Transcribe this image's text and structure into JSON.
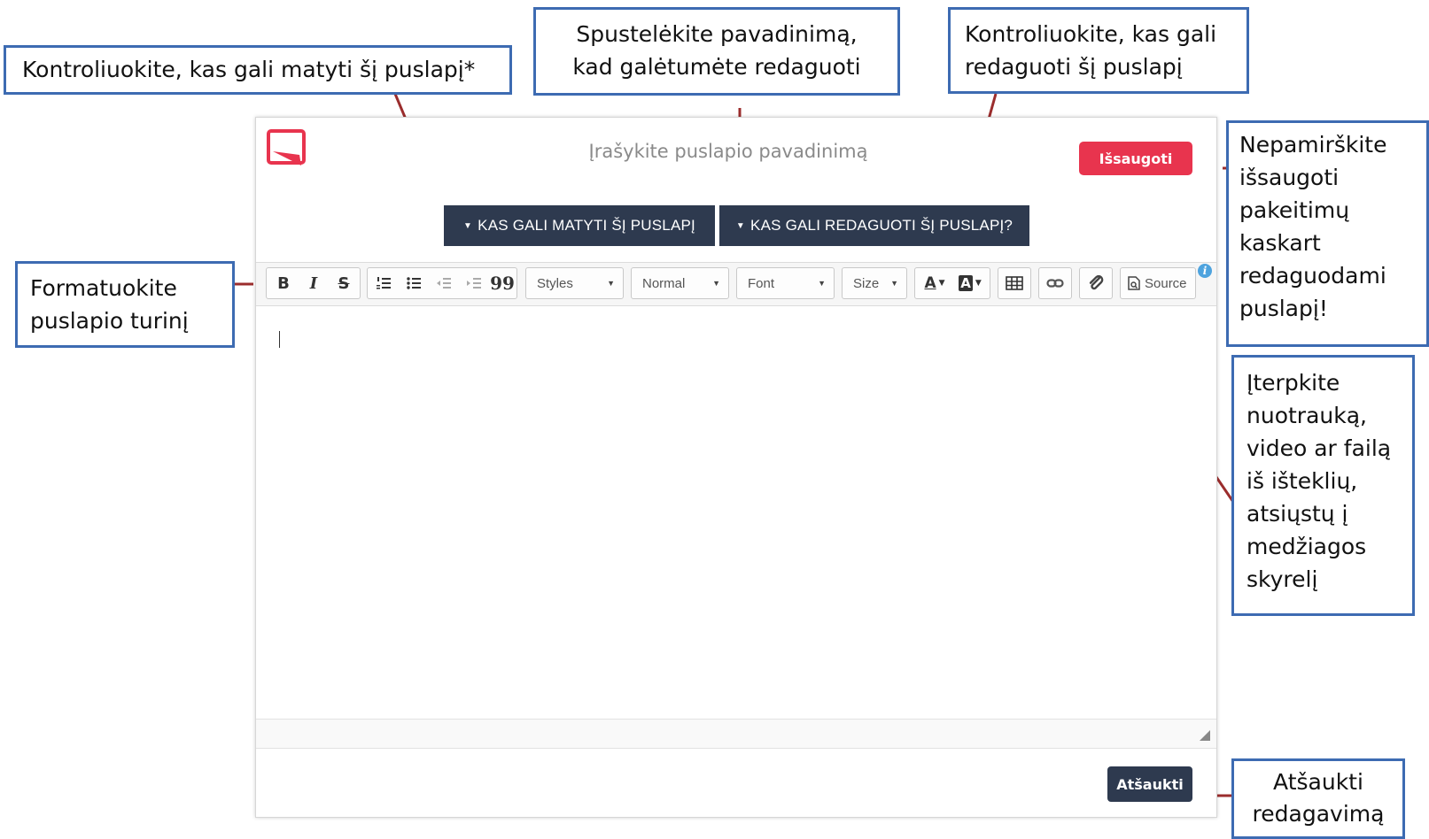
{
  "callouts": {
    "view_permissions": "Kontroliuokite, kas gali matyti šį puslapį*",
    "title_edit": "Spustelėkite pavadinimą,\nkad galėtumėte redaguoti",
    "edit_permissions": "Kontroliuokite, kas gali\nredaguoti šį puslapį",
    "save_reminder": "Nepamirškite\nišsaugoti\npakeitimų\nkaskart\nredaguodami\npuslapį!",
    "format_content": "Formatuokite\npuslapio turinį",
    "insert_media": "Įterpkite\nnuotrauką,\nvideo ar failą\niš išteklių,\natsiųstų į\nmedžiagos\nskyrelį",
    "cancel_editing": "Atšaukti\nredagavimą"
  },
  "editor": {
    "title_placeholder": "Įrašykite puslapio pavadinimą",
    "save_label": "Išsaugoti",
    "view_perm_label": "KAS GALI MATYTI ŠĮ PUSLAPĮ",
    "edit_perm_label": "KAS GALI REDAGUOTI ŠĮ PUSLAPĮ?",
    "cancel_label": "Atšaukti",
    "accent_color": "#e8344e",
    "dark_button_color": "#2e3a4f",
    "callout_border_color": "#3d6bb2",
    "leader_color": "#9b2d2d"
  },
  "toolbar": {
    "bold": "B",
    "italic": "I",
    "strike": "S",
    "styles": "Styles",
    "format": "Normal",
    "font": "Font",
    "size": "Size",
    "source": "Source",
    "text_color": "A",
    "bg_color": "A",
    "blockquote": "99",
    "info": "i",
    "icons": [
      "bold-icon",
      "italic-icon",
      "strikethrough-icon",
      "numbered-list-icon",
      "bulleted-list-icon",
      "outdent-icon",
      "indent-icon",
      "blockquote-icon",
      "text-color-icon",
      "background-color-icon",
      "table-icon",
      "link-icon",
      "attachment-icon",
      "source-icon",
      "info-icon"
    ]
  }
}
